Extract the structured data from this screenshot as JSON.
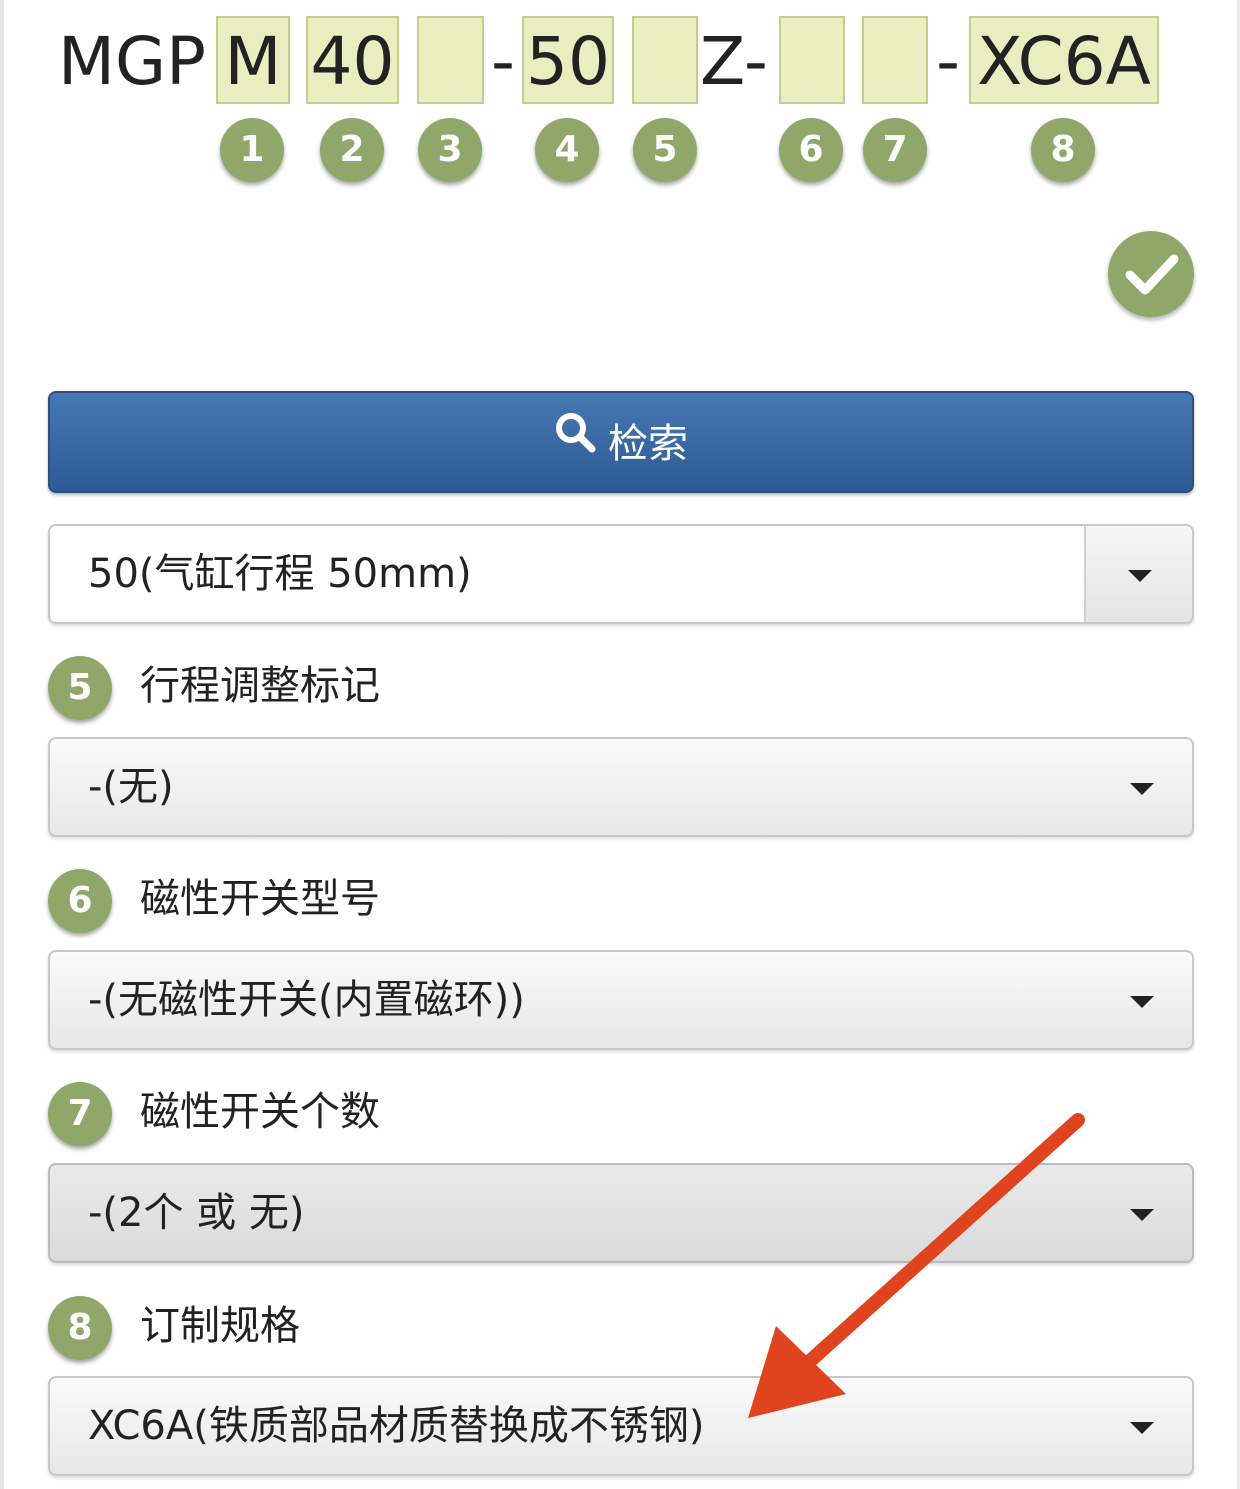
{
  "part_number": {
    "prefix": "MGP",
    "fields": [
      {
        "value": "M"
      },
      {
        "value": "40"
      },
      {
        "value": ""
      },
      {
        "value": "50"
      },
      {
        "value": ""
      },
      {
        "value": ""
      },
      {
        "value": ""
      },
      {
        "value": "XC6A"
      }
    ],
    "separators": [
      "-",
      "Z-",
      "-"
    ],
    "numbers": [
      "1",
      "2",
      "3",
      "4",
      "5",
      "6",
      "7",
      "8"
    ]
  },
  "search_button": {
    "label": "检索"
  },
  "stroke_select": {
    "value": "50(气缸行程 50mm)"
  },
  "options": [
    {
      "number": "5",
      "label": "行程调整标记",
      "value": "-(无)"
    },
    {
      "number": "6",
      "label": "磁性开关型号",
      "value": "-(无磁性开关(内置磁环))"
    },
    {
      "number": "7",
      "label": "磁性开关个数",
      "value": "-(2个 或 无)"
    },
    {
      "number": "8",
      "label": "订制规格",
      "value": "XC6A(铁质部品材质替换成不锈钢)"
    }
  ],
  "colors": {
    "accent_green": "#8fa768",
    "button_blue": "#3a6aa6",
    "field_yellow": "#e9eec0",
    "annotation_red": "#e0441e"
  },
  "icons": {
    "search": "search-icon",
    "check": "check-icon",
    "dropdown": "chevron-down-icon",
    "annotation": "red-arrow-annotation"
  }
}
